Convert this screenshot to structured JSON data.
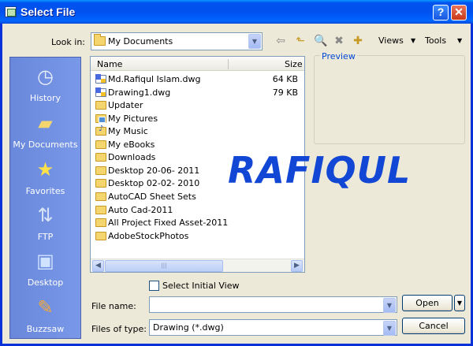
{
  "window": {
    "title": "Select File"
  },
  "titlebar": {
    "help_label": "?",
    "close_label": "✕"
  },
  "lookin": {
    "label": "Look in:",
    "value": "My Documents"
  },
  "toolbar": {
    "views_label": "Views",
    "tools_label": "Tools",
    "icons": [
      "back-icon",
      "up-folder-icon",
      "search-web-icon",
      "delete-icon",
      "new-folder-icon"
    ]
  },
  "places": [
    {
      "label": "History",
      "icon": "history-icon"
    },
    {
      "label": "My Documents",
      "icon": "my-documents-icon"
    },
    {
      "label": "Favorites",
      "icon": "favorites-star-icon"
    },
    {
      "label": "FTP",
      "icon": "ftp-icon"
    },
    {
      "label": "Desktop",
      "icon": "desktop-icon"
    },
    {
      "label": "Buzzsaw",
      "icon": "buzzsaw-icon"
    }
  ],
  "list": {
    "columns": {
      "name": "Name",
      "size": "Size"
    },
    "rows": [
      {
        "name": "Md.Rafiqul Islam.dwg",
        "size": "64 KB",
        "kind": "dwg"
      },
      {
        "name": "Drawing1.dwg",
        "size": "79 KB",
        "kind": "dwg"
      },
      {
        "name": "Updater",
        "size": "",
        "kind": "folder"
      },
      {
        "name": "My Pictures",
        "size": "",
        "kind": "pictures"
      },
      {
        "name": "My Music",
        "size": "",
        "kind": "music"
      },
      {
        "name": "My eBooks",
        "size": "",
        "kind": "folder"
      },
      {
        "name": "Downloads",
        "size": "",
        "kind": "folder"
      },
      {
        "name": "Desktop 20-06- 2011",
        "size": "",
        "kind": "folder"
      },
      {
        "name": "Desktop 02-02- 2010",
        "size": "",
        "kind": "folder"
      },
      {
        "name": "AutoCAD Sheet Sets",
        "size": "",
        "kind": "folder"
      },
      {
        "name": "Auto Cad-2011",
        "size": "",
        "kind": "folder"
      },
      {
        "name": "All Project Fixed Asset-2011",
        "size": "",
        "kind": "folder"
      },
      {
        "name": "AdobeStockPhotos",
        "size": "",
        "kind": "folder"
      }
    ]
  },
  "preview": {
    "label": "Preview"
  },
  "watermark": {
    "text": "RAFIQUL"
  },
  "options": {
    "select_initial_view_label": "Select Initial View",
    "select_initial_view_checked": false
  },
  "filename": {
    "label": "File name:",
    "value": ""
  },
  "filetype": {
    "label": "Files of type:",
    "value": "Drawing (*.dwg)"
  },
  "buttons": {
    "open_label": "Open",
    "cancel_label": "Cancel"
  }
}
